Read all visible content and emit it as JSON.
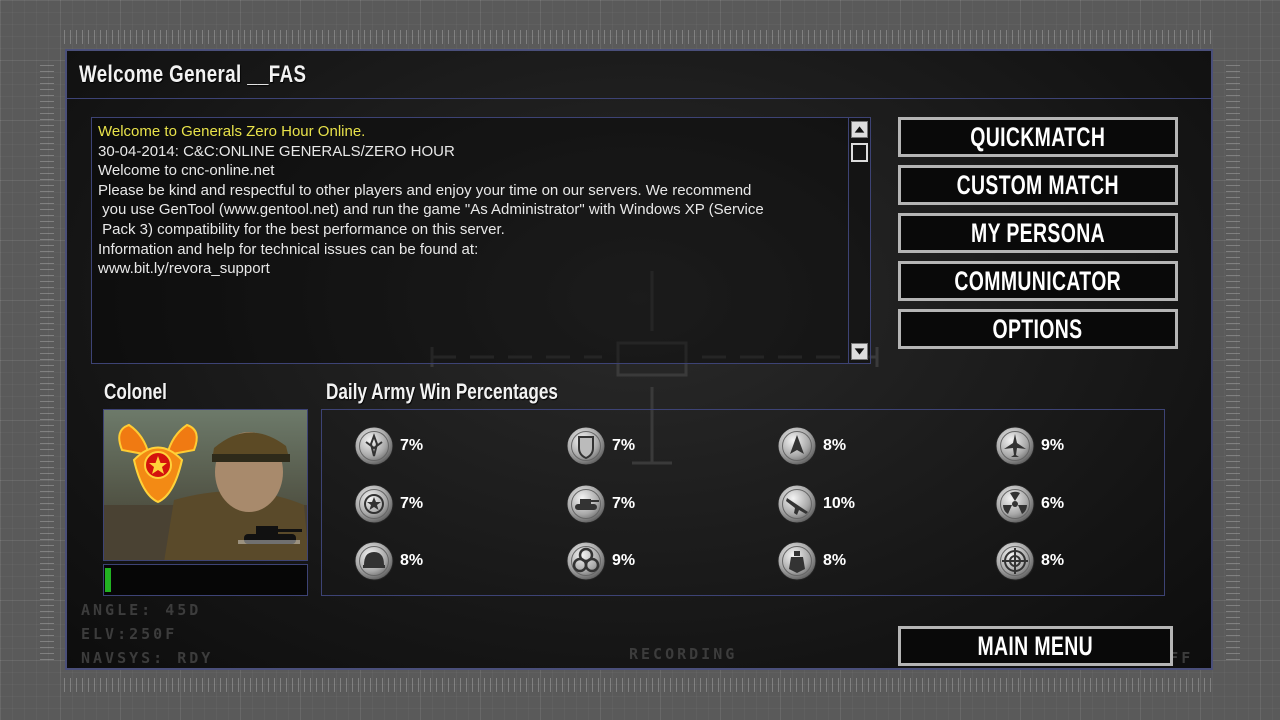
{
  "title": "Welcome General __FAS",
  "messages": [
    {
      "text": "Welcome to Generals Zero Hour Online.",
      "highlight": true
    },
    {
      "text": "",
      "highlight": false
    },
    {
      "text": "30-04-2014: C&C:ONLINE GENERALS/ZERO HOUR",
      "highlight": false
    },
    {
      "text": "",
      "highlight": false
    },
    {
      "text": "Welcome to cnc-online.net",
      "highlight": false
    },
    {
      "text": "",
      "highlight": false
    },
    {
      "text": "Please be kind and respectful to other players and enjoy your time on our servers. We recommend",
      "highlight": false
    },
    {
      "text": " you use GenTool (www.gentool.net) and run the game \"As Administrator\" with Windows XP (Service",
      "highlight": false
    },
    {
      "text": " Pack 3) compatibility for the best performance on this server.",
      "highlight": false
    },
    {
      "text": "",
      "highlight": false
    },
    {
      "text": "Information and help for technical issues can be found at:",
      "highlight": false
    },
    {
      "text": "www.bit.ly/revora_support",
      "highlight": false
    }
  ],
  "menu": {
    "quickmatch": "QUICKMATCH",
    "custom_match": "CUSTOM MATCH",
    "my_persona": "MY PERSONA",
    "communicator": "COMMUNICATOR",
    "options": "OPTIONS",
    "main_menu": "MAIN MENU"
  },
  "rank": {
    "label": "Colonel",
    "progress": 0.03
  },
  "stats": {
    "label": "Daily Army Win Percentages",
    "armies": [
      {
        "icon": "usa-emblem-icon",
        "pct": "7%"
      },
      {
        "icon": "shield-emblem-icon",
        "pct": "7%"
      },
      {
        "icon": "missile-emblem-icon",
        "pct": "8%"
      },
      {
        "icon": "jet-emblem-icon",
        "pct": "9%"
      },
      {
        "icon": "star-emblem-icon",
        "pct": "7%"
      },
      {
        "icon": "tank-emblem-icon",
        "pct": "7%"
      },
      {
        "icon": "rifle-emblem-icon",
        "pct": "10%"
      },
      {
        "icon": "radiation-emblem-icon",
        "pct": "6%"
      },
      {
        "icon": "helmet-emblem-icon",
        "pct": "8%"
      },
      {
        "icon": "biohazard-emblem-icon",
        "pct": "9%"
      },
      {
        "icon": "grenade-emblem-icon",
        "pct": "8%"
      },
      {
        "icon": "target-emblem-icon",
        "pct": "8%"
      }
    ]
  },
  "hud": {
    "angle": "ANGLE: 45D",
    "elv": "ELV:250F",
    "navsys": "NAVSYS: RDY",
    "recording": "RECORDING",
    "sis": "SIS: OFF"
  }
}
